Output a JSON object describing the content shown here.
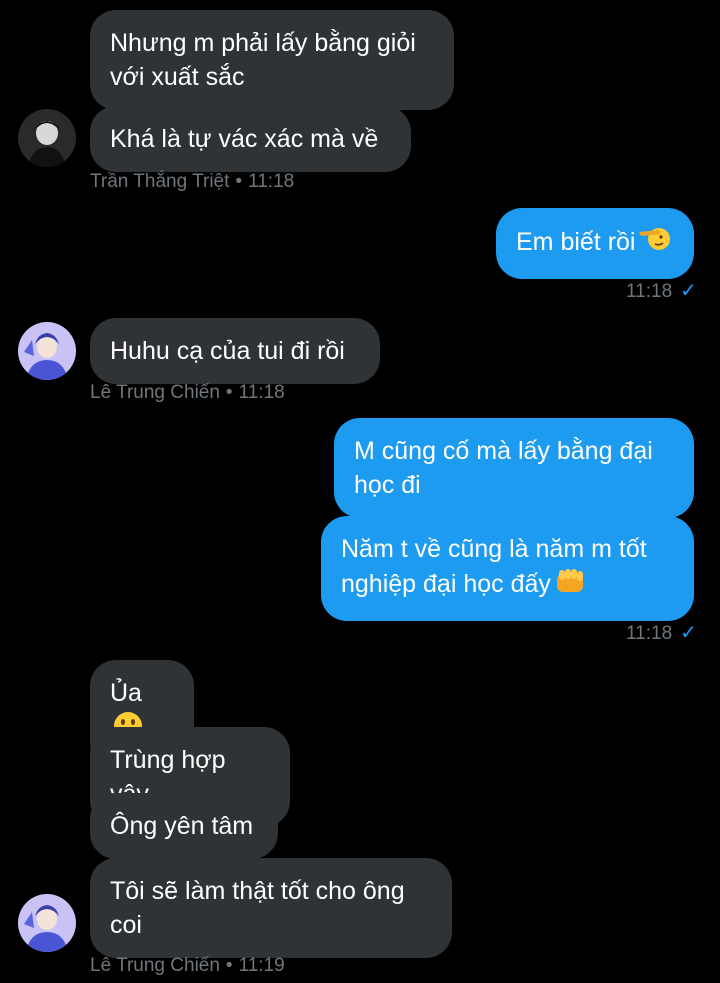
{
  "messages": [
    {
      "id": "m1",
      "from": "other",
      "text": "Nhưng m phải lấy bằng giỏi với xuất sắc"
    },
    {
      "id": "m2",
      "from": "other",
      "text": "Khá là tự vác xác mà về"
    },
    {
      "id": "m3",
      "from": "me",
      "text": "Em biết rồi",
      "emoji_icon": "saluting-face-icon"
    },
    {
      "id": "m4",
      "from": "other",
      "text": "Huhu cạ của tui đi rồi"
    },
    {
      "id": "m5",
      "from": "me",
      "text": "M cũng cố mà lấy bằng đại học đi"
    },
    {
      "id": "m6",
      "from": "me",
      "text": "Năm t về cũng là năm m tốt nghiệp đại học đấy",
      "emoji_icon": "raised-fist-icon"
    },
    {
      "id": "m7",
      "from": "other",
      "text": "Ủa",
      "emoji_icon": "grinning-face-icon"
    },
    {
      "id": "m8",
      "from": "other",
      "text": "Trùng hợp vậy"
    },
    {
      "id": "m9",
      "from": "other",
      "text": "Ông yên tâm"
    },
    {
      "id": "m10",
      "from": "other",
      "text": "Tôi sẽ làm thật tốt cho ông coi"
    }
  ],
  "meta": {
    "g1": {
      "sender": "Trần Thắng Triệt",
      "time": "11:18"
    },
    "g2": {
      "time": "11:18",
      "status_icon": "sent-check-icon"
    },
    "g3": {
      "sender": "Lê Trung Chiến",
      "time": "11:18"
    },
    "g4": {
      "time": "11:18",
      "status_icon": "sent-check-icon"
    },
    "g5": {
      "sender": "Lê Trung Chiến",
      "time": "11:19"
    }
  },
  "separator": "•",
  "check_glyph": "✓",
  "colors": {
    "background": "#000000",
    "incoming": "#2f3336",
    "outgoing": "#1d9bf0",
    "meta": "#71767b"
  },
  "avatars": [
    {
      "id": "avatar-tran-thang-triet",
      "style": "dark-portrait"
    },
    {
      "id": "avatar-le-trung-chien",
      "style": "blue-illustration"
    }
  ]
}
